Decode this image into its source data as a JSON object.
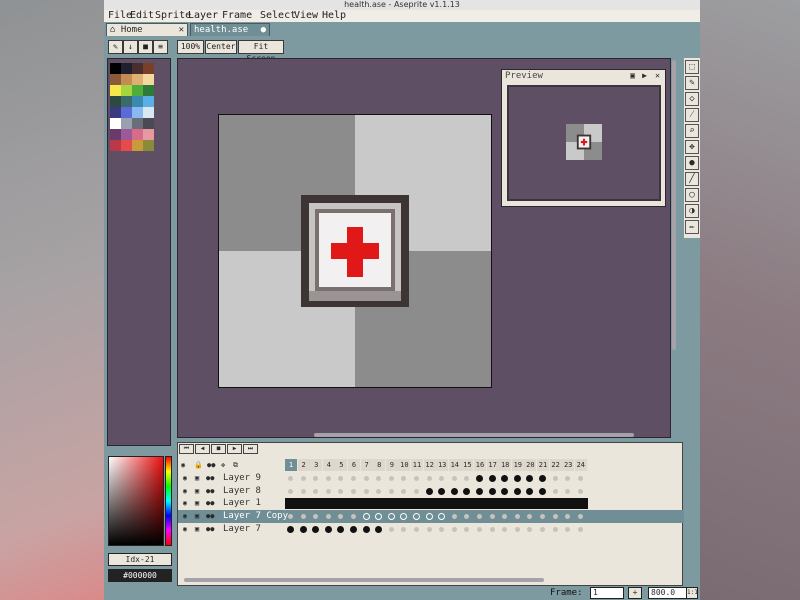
{
  "window": {
    "title": "health.ase - Aseprite v1.1.13"
  },
  "menu": [
    "File",
    "Edit",
    "Sprite",
    "Layer",
    "Frame",
    "Select",
    "View",
    "Help"
  ],
  "tabs": [
    {
      "label": "Home"
    },
    {
      "label": "health.ase"
    }
  ],
  "toolbar": {
    "zoom": "100%",
    "center": "Center",
    "fit": "Fit Screen"
  },
  "preview": {
    "title": "Preview"
  },
  "colorbar": {
    "index": "Idx-21",
    "hex": "#000000"
  },
  "frames": [
    "1",
    "2",
    "3",
    "4",
    "5",
    "6",
    "7",
    "8",
    "9",
    "10",
    "11",
    "12",
    "13",
    "14",
    "15",
    "16",
    "17",
    "18",
    "19",
    "20",
    "21",
    "22",
    "23",
    "24"
  ],
  "layers": [
    {
      "name": "Layer 9",
      "cels": "eeeeeeeeeeeeeeeddddddeee"
    },
    {
      "name": "Layer 8",
      "cels": "eeeeeeeeeeeddddddddddeee"
    },
    {
      "name": "Layer 1",
      "cels": "LLLLLLLLLLLLLLLLLLLLLLLL"
    },
    {
      "name": "Layer 7 Copy",
      "cels": "eeeeeeRRRRRRReeeeeeeeeee"
    },
    {
      "name": "Layer 7",
      "cels": "ddddddddeeeeeeeeeeeeeeee"
    }
  ],
  "status": {
    "frame_label": "Frame:",
    "frame_value": "1",
    "zoom": "800.0"
  },
  "palette_colors": [
    "#000000",
    "#1f1f2e",
    "#4a2e2e",
    "#7a3f2a",
    "#8a5a3a",
    "#c48c54",
    "#dfb070",
    "#f3d9a0",
    "#f6e84a",
    "#a4d640",
    "#4fae3a",
    "#2e7a3a",
    "#2e4a40",
    "#3a6a6a",
    "#3a8ab0",
    "#5ab0e6",
    "#3a3a80",
    "#5a6ad6",
    "#8ab8f0",
    "#d8e8f0",
    "#ffffff",
    "#9aa0b0",
    "#6a6e7a",
    "#4a4a54",
    "#6a3a6a",
    "#9a5a9a",
    "#d86a8a",
    "#e69aa0",
    "#b83a4a",
    "#e64a4a",
    "#c89a3a",
    "#8a8a3a"
  ],
  "accent": "#6f8e96",
  "sprite_accent": "#e01818"
}
